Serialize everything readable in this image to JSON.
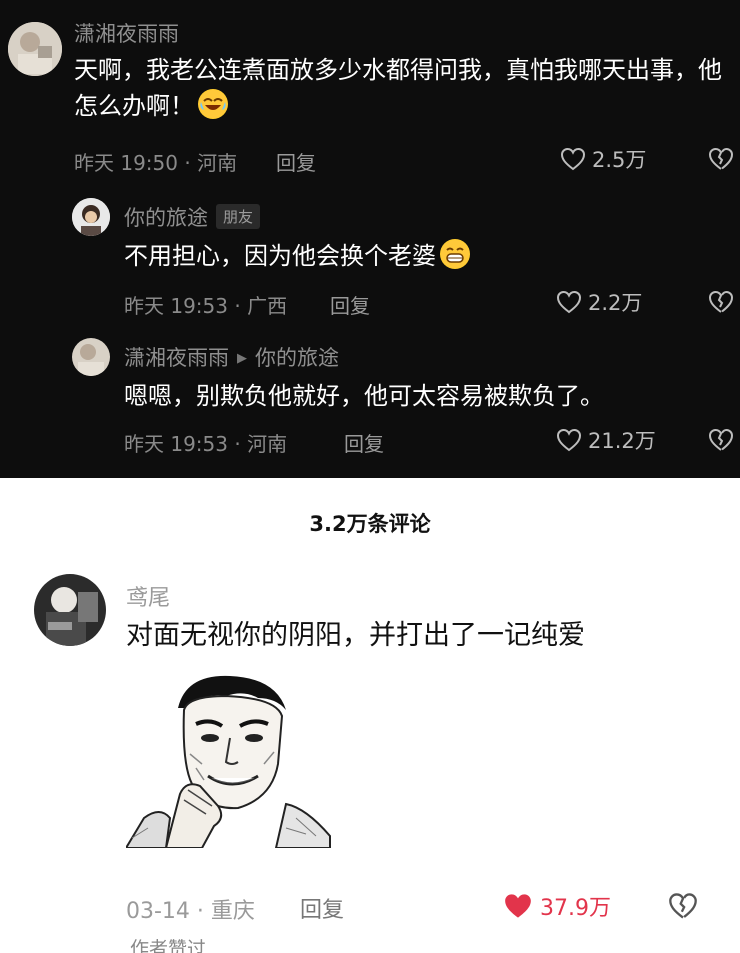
{
  "comments_dark": [
    {
      "username": "潇湘夜雨雨",
      "text": "天啊，我老公连煮面放多少水都得问我，真怕我哪天出事，他怎么办啊！",
      "emoji": "laughing-crying-emoji",
      "meta": "昨天 19:50 · 河南",
      "reply_label": "回复",
      "likes": "2.5万"
    },
    {
      "username": "你的旅途",
      "badge": "朋友",
      "text": "不用担心，因为他会换个老婆",
      "emoji": "grinning-emoji",
      "meta": "昨天 19:53 · 广西",
      "reply_label": "回复",
      "likes": "2.2万"
    },
    {
      "username": "潇湘夜雨雨",
      "reply_to": "你的旅途",
      "text": "嗯嗯，别欺负他就好，他可太容易被欺负了。",
      "meta": "昨天 19:53 · 河南",
      "reply_label": "回复",
      "likes": "21.2万"
    }
  ],
  "comment_count_header": "3.2万条评论",
  "comment_light": {
    "username": "鸢尾",
    "text": "对面无视你的阴阳，并打出了一记纯爱",
    "image": "manga-man-smiling-sticker",
    "meta": "03-14 · 重庆",
    "reply_label": "回复",
    "likes": "37.9万",
    "liked": true,
    "footer": "作者赞过"
  },
  "colors": {
    "dark_bg": "#0d0d0d",
    "like_red": "#e2344b",
    "muted": "#8f8f8f"
  }
}
